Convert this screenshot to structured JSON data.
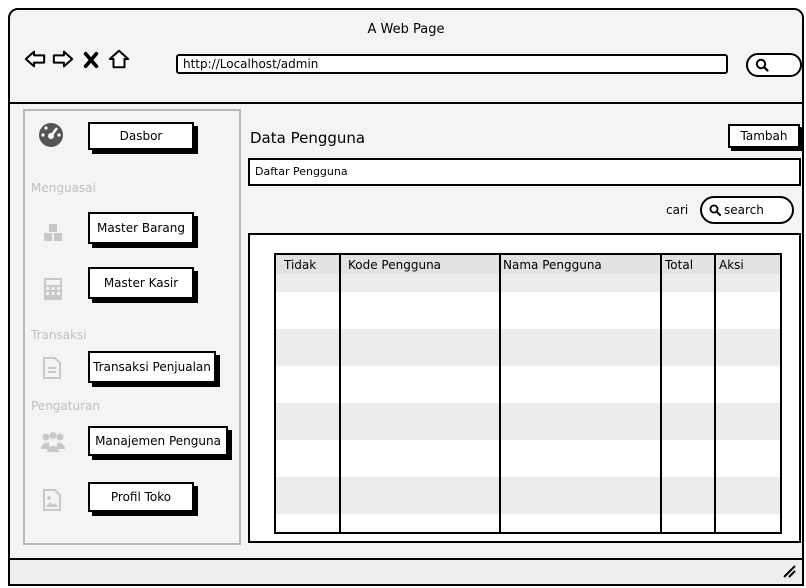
{
  "browser": {
    "title": "A Web Page",
    "url": "http://Localhost/admin"
  },
  "sidebar": {
    "items": [
      {
        "label": "Dasbor",
        "icon": "dashboard-gauge-icon"
      },
      {
        "label": "Master Barang",
        "icon": "cubes-icon"
      },
      {
        "label": "Master Kasir",
        "icon": "calculator-icon"
      },
      {
        "label": "Transaksi Penjualan",
        "icon": "document-icon"
      },
      {
        "label": "Manajemen Penguna",
        "icon": "users-icon"
      },
      {
        "label": "Profil Toko",
        "icon": "image-file-icon"
      }
    ],
    "sections": [
      "Menguasai",
      "Transaksi",
      "Pengaturan"
    ]
  },
  "main": {
    "title": "Data Pengguna",
    "add_button": "Tambah",
    "list_title": "Daftar Pengguna",
    "search_label": "cari",
    "search_placeholder": "search",
    "table": {
      "columns": [
        "Tidak",
        "Kode Pengguna",
        "Nama Pengguna",
        "Total",
        "Aksi"
      ],
      "rows": []
    }
  },
  "colors": {
    "border": "#000000",
    "background": "#f4f4f4",
    "muted_text": "#c0c0c0",
    "row_stripe": "#ececec"
  }
}
